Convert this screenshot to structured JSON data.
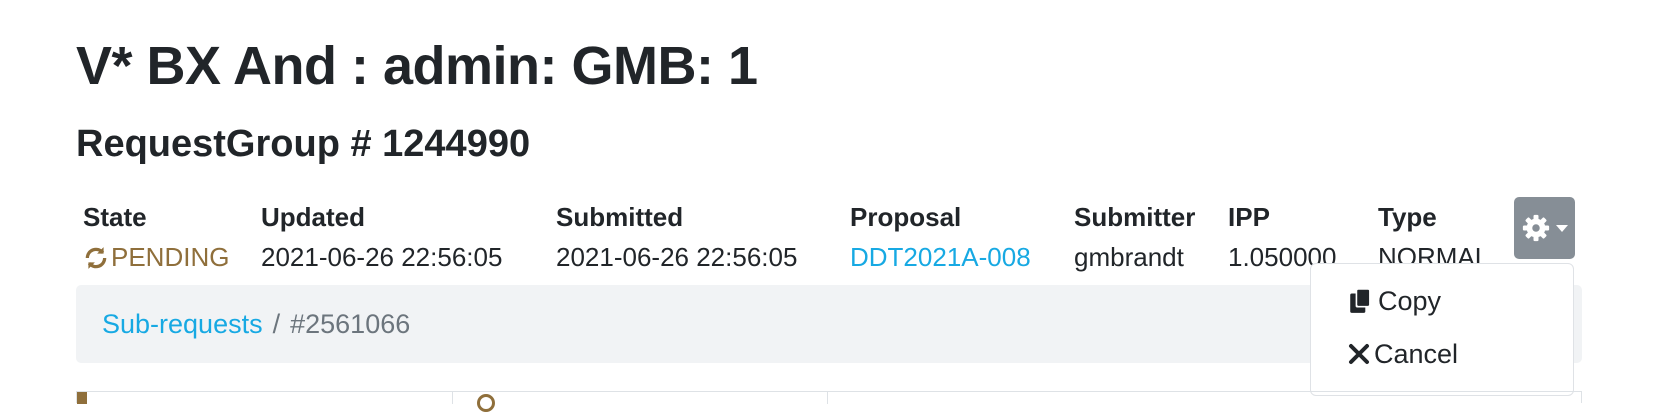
{
  "page": {
    "title": "V* BX And : admin: GMB: 1",
    "subtitle": "RequestGroup # 1244990"
  },
  "summary": {
    "state_label": "State",
    "state_value": "PENDING",
    "updated_label": "Updated",
    "updated_value": "2021-06-26 22:56:05",
    "submitted_label": "Submitted",
    "submitted_value": "2021-06-26 22:56:05",
    "proposal_label": "Proposal",
    "proposal_value": "DDT2021A-008",
    "submitter_label": "Submitter",
    "submitter_value": "gmbrandt",
    "ipp_label": "IPP",
    "ipp_value": "1.050000",
    "type_label": "Type",
    "type_value": "NORMAL"
  },
  "breadcrumb": {
    "link": "Sub-requests",
    "separator": "/",
    "current": "#2561066"
  },
  "actions_menu": {
    "copy_label": "Copy",
    "cancel_label": "Cancel"
  },
  "colors": {
    "pending": "#8f6f3b",
    "link": "#17a9e3",
    "gear_button": "#868e96"
  },
  "icons": {
    "state": "sync-icon",
    "menu_toggle": "gear-icon",
    "copy": "copy-icon",
    "cancel": "close-icon"
  }
}
